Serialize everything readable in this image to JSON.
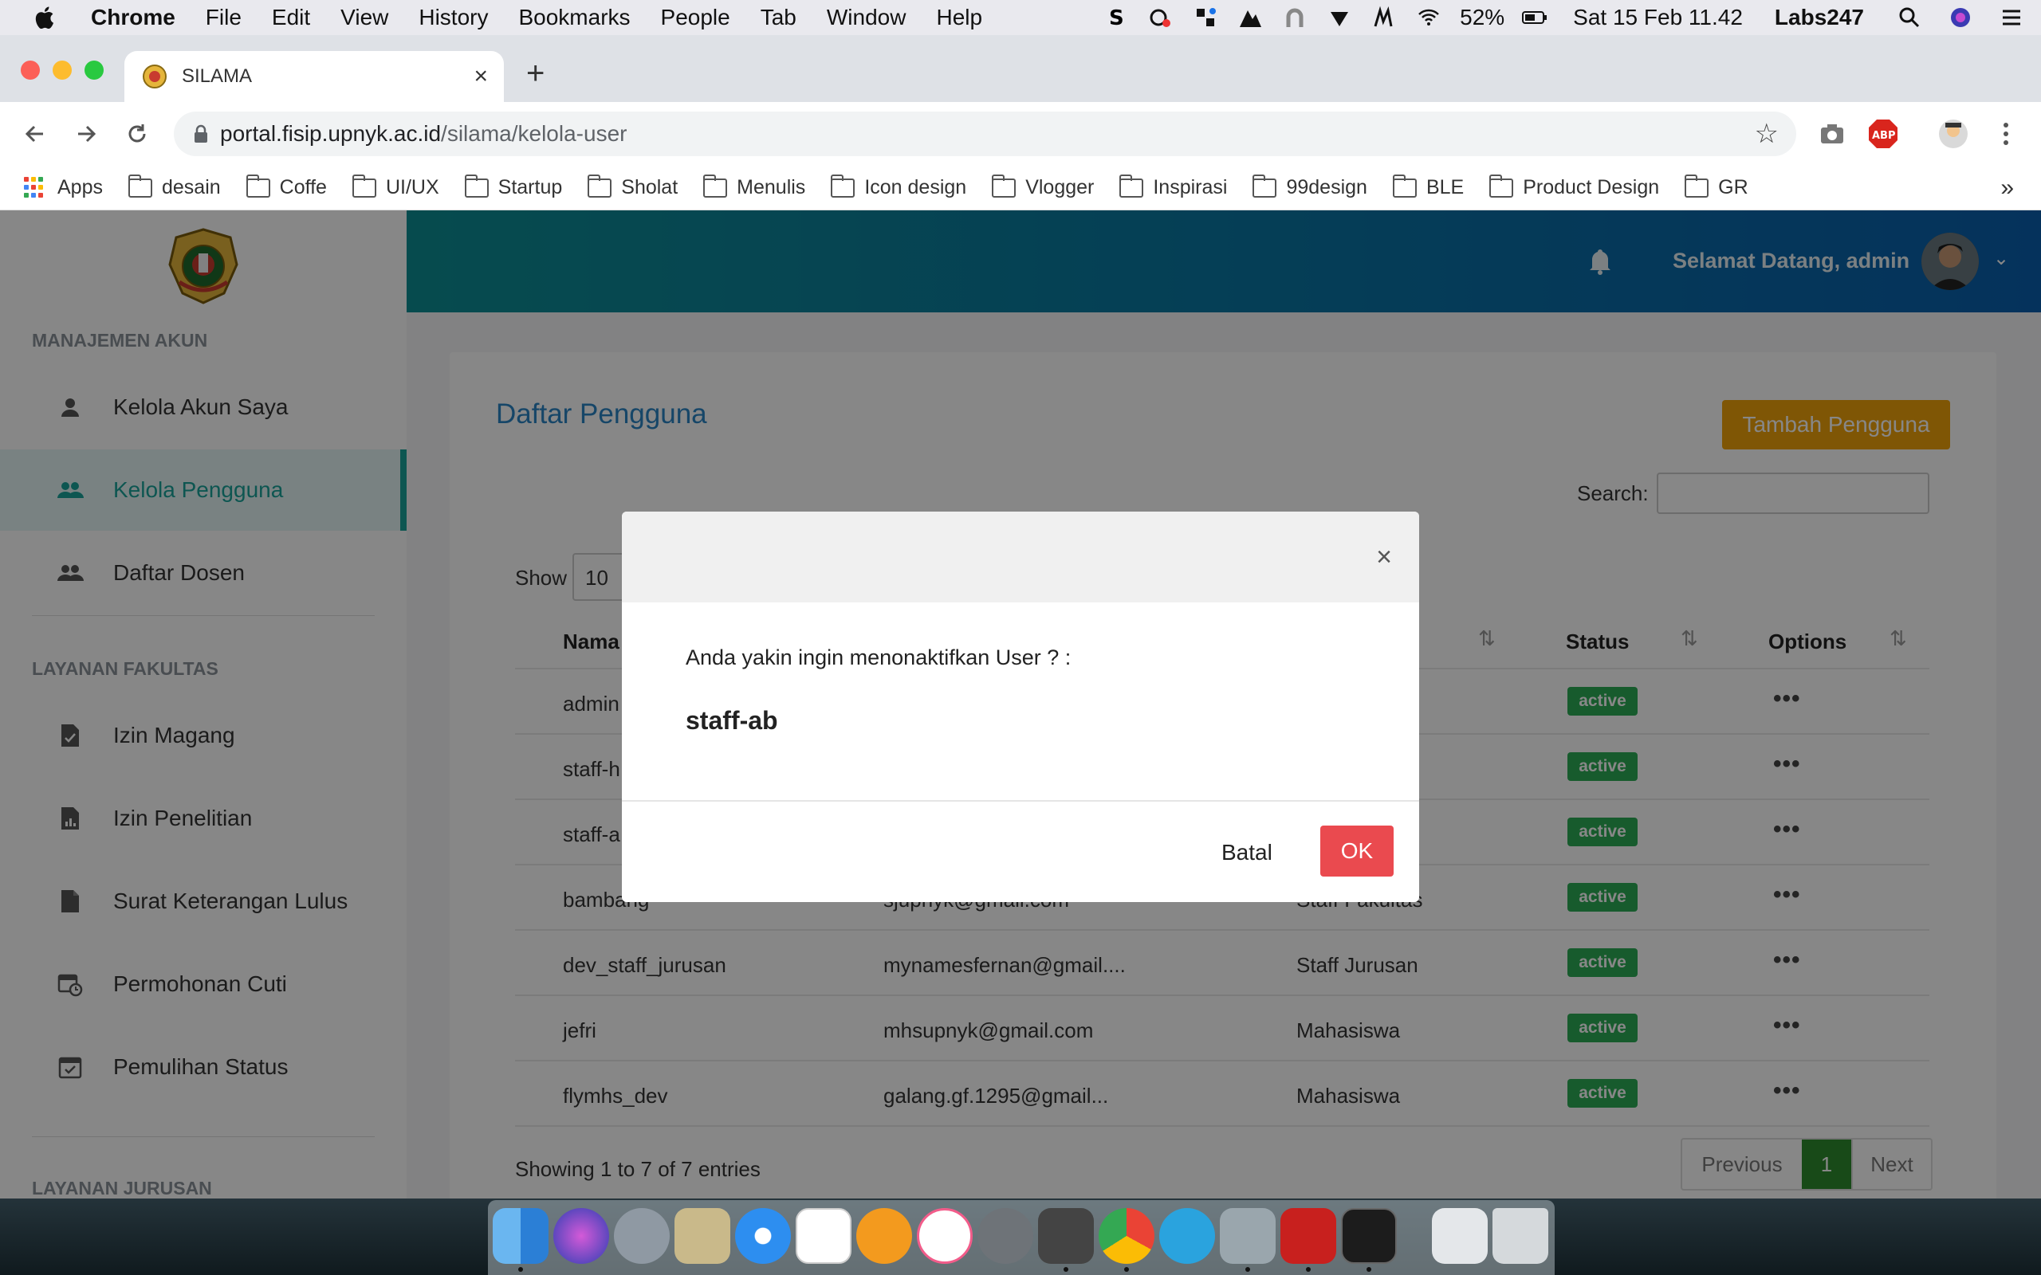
{
  "menubar": {
    "app_name": "Chrome",
    "items": [
      "File",
      "Edit",
      "View",
      "History",
      "Bookmarks",
      "People",
      "Tab",
      "Window",
      "Help"
    ],
    "battery": "52%",
    "clock": "Sat 15 Feb  11.42",
    "host": "Labs247"
  },
  "browser": {
    "tab_title": "SILAMA",
    "url_host": "portal.fisip.upnyk.ac.id",
    "url_path": "/silama/kelola-user",
    "bookmarks": [
      "Apps",
      "desain",
      "Coffe",
      "UI/UX",
      "Startup",
      "Sholat",
      "Menulis",
      "Icon design",
      "Vlogger",
      "Inspirasi",
      "99design",
      "BLE",
      "Product Design",
      "GR"
    ],
    "bookmarks_more": "»"
  },
  "sidebar": {
    "section1": "MANAJEMEN AKUN",
    "item_akun_saya": "Kelola Akun Saya",
    "item_pengguna": "Kelola Pengguna",
    "item_dosen": "Daftar Dosen",
    "section2": "LAYANAN FAKULTAS",
    "item_magang": "Izin Magang",
    "item_penelitian": "Izin Penelitian",
    "item_lulus": "Surat Keterangan Lulus",
    "item_cuti": "Permohonan Cuti",
    "item_pemulihan": "Pemulihan Status",
    "section3": "LAYANAN JURUSAN"
  },
  "topbar": {
    "welcome": "Selamat Datang, admin"
  },
  "content": {
    "title": "Daftar Pengguna",
    "add_button": "Tambah Pengguna",
    "search_label": "Search:",
    "show_label": "Show",
    "show_value": "10",
    "headers": {
      "nama": "Nama",
      "status": "Status",
      "options": "Options"
    },
    "rows": [
      {
        "nama": "admin",
        "email": "",
        "role": "",
        "status": "active"
      },
      {
        "nama": "staff-h",
        "email": "",
        "role": "",
        "status": "active"
      },
      {
        "nama": "staff-a",
        "email": "",
        "role": "",
        "status": "active"
      },
      {
        "nama": "bambang",
        "email": "sjupnyk@gmail.com",
        "role": "Staff Fakultas",
        "status": "active"
      },
      {
        "nama": "dev_staff_jurusan",
        "email": "mynamesfernan@gmail....",
        "role": "Staff Jurusan",
        "status": "active"
      },
      {
        "nama": "jefri",
        "email": "mhsupnyk@gmail.com",
        "role": "Mahasiswa",
        "status": "active"
      },
      {
        "nama": "flymhs_dev",
        "email": "galang.gf.1295@gmail...",
        "role": "Mahasiswa",
        "status": "active"
      }
    ],
    "options_glyph": "•••",
    "entries_info": "Showing 1 to 7 of 7 entries",
    "pager": {
      "previous": "Previous",
      "current": "1",
      "next": "Next"
    }
  },
  "modal": {
    "close": "×",
    "question": "Anda yakin ingin menonaktifkan User ? :",
    "username": "staff-ab",
    "cancel": "Batal",
    "ok": "OK"
  },
  "colors": {
    "accent": "#1aa39a",
    "link_blue": "#2b84c4",
    "add_button": "#f0a20a",
    "status_active": "#2cad55",
    "ok_button": "#ea4a4f"
  }
}
